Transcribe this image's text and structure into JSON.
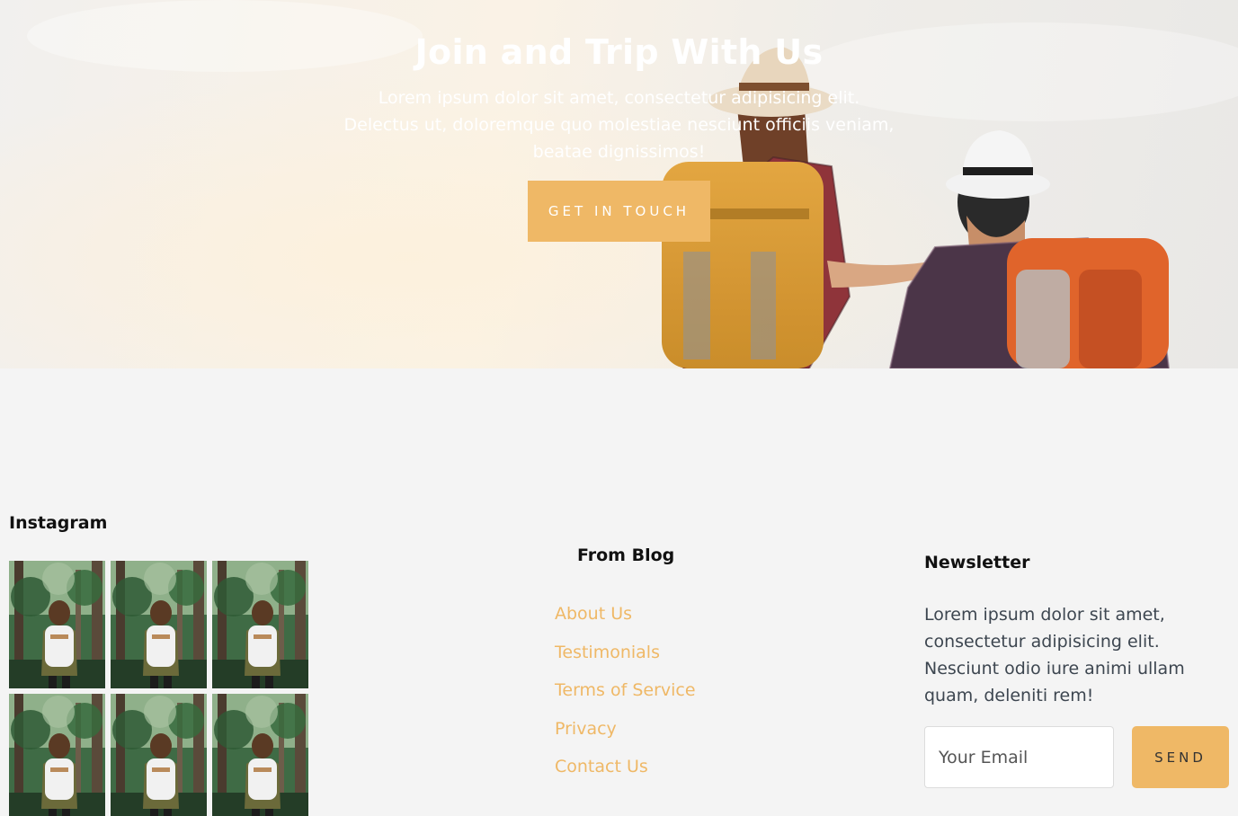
{
  "hero": {
    "title": "Join and Trip With Us",
    "text": "Lorem ipsum dolor sit amet, consectetur adipisicing elit. Delectus ut, doloremque quo molestiae nesciunt officiis veniam, beatae dignissimos!",
    "button_label": "GET IN TOUCH"
  },
  "instagram": {
    "title": "Instagram",
    "thumbnails": [
      "hiker-photo",
      "hiker-photo",
      "hiker-photo",
      "hiker-photo",
      "hiker-photo",
      "hiker-photo"
    ]
  },
  "blog": {
    "title": "From Blog",
    "links": [
      "About Us",
      "Testimonials",
      "Terms of Service",
      "Privacy",
      "Contact Us"
    ]
  },
  "newsletter": {
    "title": "Newsletter",
    "text": "Lorem ipsum dolor sit amet, consectetur adipisicing elit. Nesciunt odio iure animi ullam quam, deleniti rem!",
    "email_placeholder": "Your Email",
    "email_value": "",
    "send_label": "SEND"
  },
  "colors": {
    "accent": "#efb866",
    "page_background": "#f4f4f4",
    "body_text": "#3d4650"
  }
}
